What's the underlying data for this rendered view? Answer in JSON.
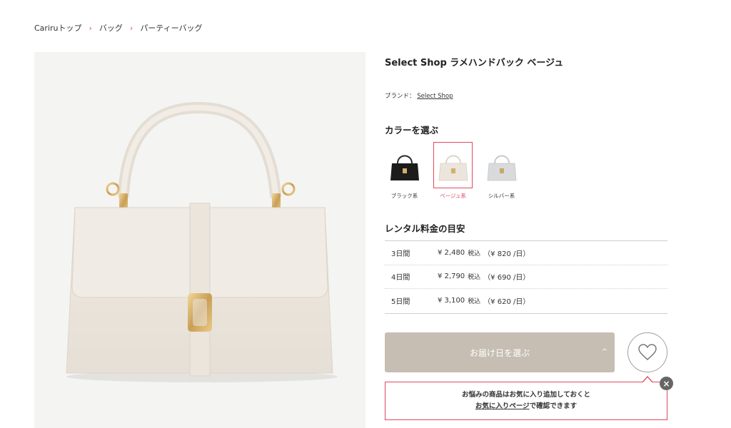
{
  "breadcrumb": {
    "items": [
      "Cariruトップ",
      "バッグ",
      "パーティーバッグ"
    ],
    "separator": "›"
  },
  "product": {
    "title": "Select Shop ラメハンドバック ベージュ",
    "brand_label": "ブランド：",
    "brand_name": "Select Shop"
  },
  "colors": {
    "heading": "カラーを選ぶ",
    "options": [
      {
        "label": "ブラック系",
        "swatch": "#1c1c1c",
        "selected": false
      },
      {
        "label": "ベージュ系",
        "swatch": "#ebe5dc",
        "selected": true
      },
      {
        "label": "シルバー系",
        "swatch": "#d9dadc",
        "selected": false
      }
    ]
  },
  "pricing": {
    "heading": "レンタル料金の目安",
    "rows": [
      {
        "days": "3日間",
        "price": "¥ 2,480",
        "tax": "税込",
        "per_day": "（¥ 820 /日）"
      },
      {
        "days": "4日間",
        "price": "¥ 2,790",
        "tax": "税込",
        "per_day": "（¥ 690 /日）"
      },
      {
        "days": "5日間",
        "price": "¥ 3,100",
        "tax": "税込",
        "per_day": "（¥ 620 /日）"
      }
    ]
  },
  "actions": {
    "delivery_label": "お届け日を選ぶ",
    "chevron": "^"
  },
  "tooltip": {
    "line1": "お悩みの商品はお気に入り追加しておくと",
    "link": "お気に入りページ",
    "line2_suffix": "で確認できます",
    "close": "×"
  },
  "theme": {
    "accent": "#e0485f",
    "button_bg": "#c6beb3",
    "bag_color": "#ece6dd",
    "hardware": "#d4af6a"
  }
}
